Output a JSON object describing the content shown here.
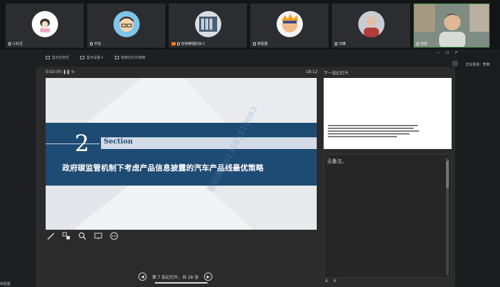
{
  "participants": [
    {
      "name": "小红旦",
      "avatar": "cartoon-girl"
    },
    {
      "name": "平扶",
      "avatar": "cartoon-boy-glasses"
    },
    {
      "name": "张钟佛理的杂人",
      "avatar": "photo-building",
      "sharing": true
    },
    {
      "name": "钟嘉露",
      "avatar": "cartoon-ninja"
    },
    {
      "name": "刘琳",
      "avatar": "photo-person"
    },
    {
      "name": "陌路",
      "avatar": "video-man",
      "active": true
    }
  ],
  "toolbar": {
    "items": [
      "显示任务栏",
      "显示设置 ▾",
      "结束幻灯片放映"
    ]
  },
  "presenter": {
    "timer": "0:02:05",
    "clock": "18:12",
    "next_label": "下一张幻灯片",
    "notes_text": "无备注。",
    "font_controls": [
      "A",
      "A"
    ]
  },
  "slide": {
    "number": "2",
    "section_label": "Section",
    "title": "政府碳监管机制下考虑产品信息披露的汽车产品线最优策略",
    "watermark": "张丽静 8613585510693"
  },
  "navigation": {
    "text": "第 7 张幻灯片，共 28 张"
  },
  "sidebar": {
    "label": "正在讲话：李爽"
  },
  "bottom_label": "钟嘉露"
}
